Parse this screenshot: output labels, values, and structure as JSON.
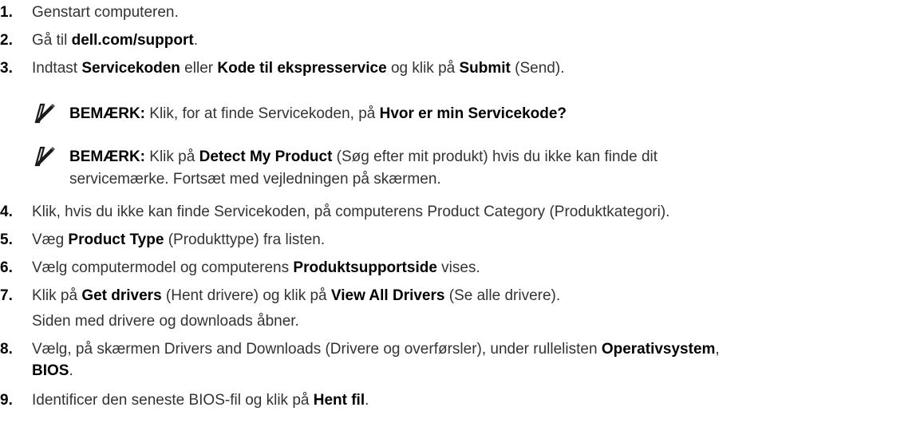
{
  "steps": [
    {
      "num": "1.",
      "parts": [
        {
          "t": "Genstart computeren.",
          "b": false
        }
      ]
    },
    {
      "num": "2.",
      "parts": [
        {
          "t": "Gå til ",
          "b": false
        },
        {
          "t": "dell.com/support",
          "b": true
        },
        {
          "t": ".",
          "b": false
        }
      ]
    },
    {
      "num": "3.",
      "parts": [
        {
          "t": "Indtast ",
          "b": false
        },
        {
          "t": "Servicekoden",
          "b": true
        },
        {
          "t": " eller ",
          "b": false
        },
        {
          "t": "Kode til ekspresservice",
          "b": true
        },
        {
          "t": " og klik på ",
          "b": false
        },
        {
          "t": "Submit",
          "b": true
        },
        {
          "t": " (Send).",
          "b": false
        }
      ]
    },
    {
      "num": "4.",
      "parts": [
        {
          "t": "Klik, hvis du ikke kan finde Servicekoden, på computerens Product Category (Produktkategori).",
          "b": false
        }
      ]
    },
    {
      "num": "5.",
      "parts": [
        {
          "t": "Væg ",
          "b": false
        },
        {
          "t": "Product Type",
          "b": true
        },
        {
          "t": " (Produkttype) fra listen.",
          "b": false
        }
      ]
    },
    {
      "num": "6.",
      "parts": [
        {
          "t": "Vælg computermodel og computerens ",
          "b": false
        },
        {
          "t": "Produktsupportside",
          "b": true
        },
        {
          "t": " vises.",
          "b": false
        }
      ]
    },
    {
      "num": "7.",
      "parts": [
        {
          "t": "Klik på ",
          "b": false
        },
        {
          "t": "Get drivers",
          "b": true
        },
        {
          "t": " (Hent drivere) og klik på ",
          "b": false
        },
        {
          "t": "View All Drivers",
          "b": true
        },
        {
          "t": " (Se alle drivere).",
          "b": false
        }
      ]
    },
    {
      "num": "8.",
      "parts": [
        {
          "t": "Vælg, på skærmen Drivers and Downloads (Drivere og overførsler), under rullelisten ",
          "b": false
        },
        {
          "t": "Operativsystem",
          "b": true
        },
        {
          "t": ",",
          "b": false
        }
      ]
    },
    {
      "num": "9.",
      "parts": [
        {
          "t": "Identificer den seneste BIOS-fil og klik på ",
          "b": false
        },
        {
          "t": "Hent fil",
          "b": true
        },
        {
          "t": ".",
          "b": false
        }
      ]
    }
  ],
  "step7_continuation": "Siden med drivere og downloads åbner.",
  "step8_continuation": [
    {
      "t": "BIOS",
      "b": true
    },
    {
      "t": ".",
      "b": false
    }
  ],
  "notes": [
    {
      "icon": "pencil-note-icon",
      "lines": [
        [
          {
            "t": "BEMÆRK:",
            "b": true
          },
          {
            "t": " Klik, for at finde Servicekoden, på ",
            "b": false
          },
          {
            "t": "Hvor er min Servicekode?",
            "b": true
          }
        ]
      ]
    },
    {
      "icon": "pencil-note-icon",
      "lines": [
        [
          {
            "t": "BEMÆRK:",
            "b": true
          },
          {
            "t": " Klik på ",
            "b": false
          },
          {
            "t": "Detect My Product",
            "b": true
          },
          {
            "t": " (Søg efter mit produkt) hvis du ikke kan finde dit",
            "b": false
          }
        ],
        [
          {
            "t": "servicemærke. Fortsæt med vejledningen på skærmen.",
            "b": false
          }
        ]
      ]
    }
  ]
}
